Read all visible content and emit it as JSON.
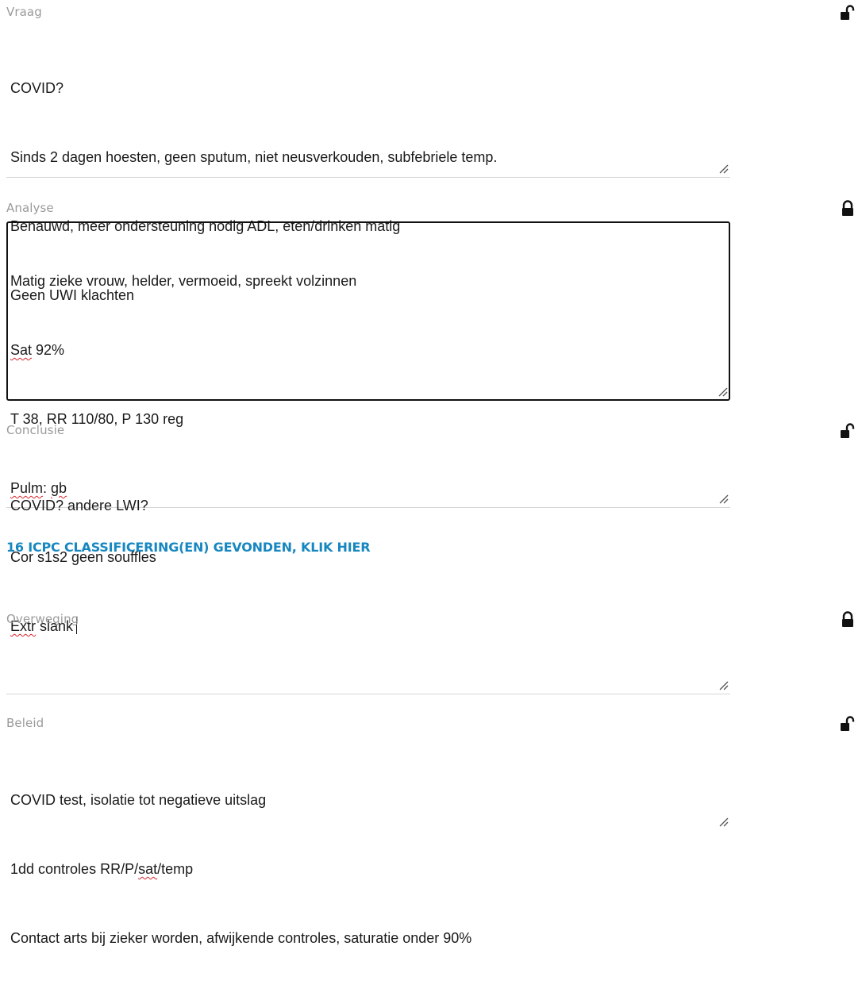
{
  "sections": {
    "vraag": {
      "label": "Vraag",
      "lock": "unlocked",
      "lines": [
        "COVID?",
        "Sinds 2 dagen hoesten, geen sputum, niet neusverkouden, subfebriele temp.",
        "Benauwd, meer ondersteuning nodig ADL, eten/drinken matig",
        "Geen UWI klachten"
      ]
    },
    "analyse": {
      "label": "Analyse",
      "lock": "locked",
      "line0": "Matig zieke vrouw, helder, vermoeid, spreekt volzinnen",
      "line1_a": "Sat",
      "line1_b": " 92%",
      "line2": "T 38, RR 110/80, P 130 reg",
      "line3_a": "Pulm",
      "line3_b": ": ",
      "line3_c": "gb",
      "line4": "Cor s1s2 geen souffles",
      "line5_a": "Extr",
      "line5_b": " slank"
    },
    "conclusie": {
      "label": "Conclusie",
      "lock": "unlocked",
      "lines": [
        "COVID? andere LWI?"
      ]
    },
    "icpc_link": "16 ICPC CLASSIFICERING(EN) GEVONDEN, KLIK HIER",
    "overweging": {
      "label": "Overweging",
      "lock": "locked",
      "lines": []
    },
    "beleid": {
      "label": "Beleid",
      "lock": "unlocked",
      "line0": "COVID test, isolatie tot negatieve uitslag",
      "line1_a": "1dd controles RR/P/",
      "line1_b": "sat",
      "line1_c": "/temp",
      "line2": "Contact arts bij zieker worden, afwijkende controles, saturatie onder 90%"
    }
  },
  "colors": {
    "label": "#9a9a9a",
    "link": "#1787c0",
    "spell_underline": "#d9262b"
  },
  "icons": {
    "unlocked": "unlocked-padlock-icon",
    "locked": "locked-padlock-icon",
    "resize": "resize-grip-icon"
  }
}
